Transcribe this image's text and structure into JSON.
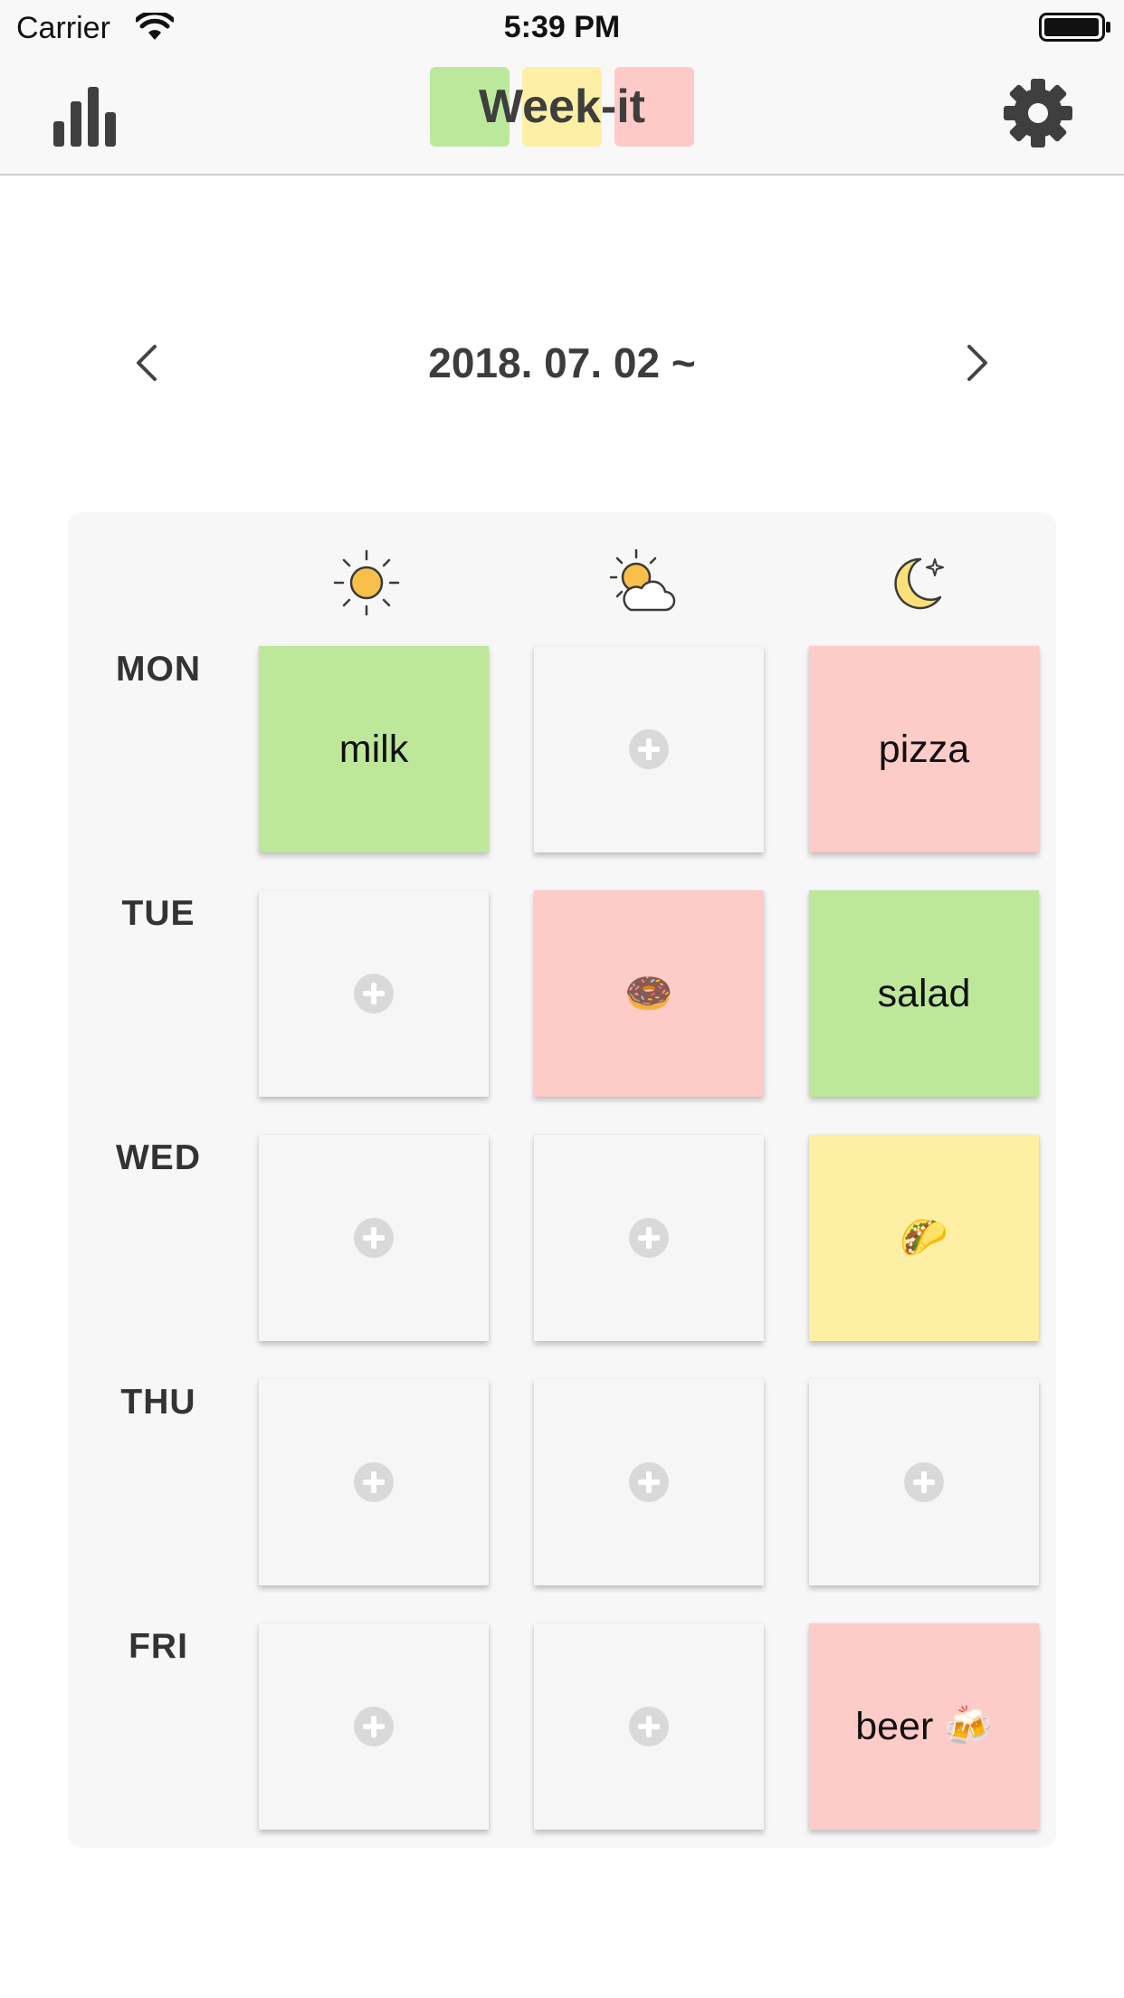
{
  "status_bar": {
    "carrier": "Carrier",
    "time": "5:39 PM"
  },
  "nav": {
    "title": "Week-it",
    "logo_colors": [
      "#bce89b",
      "#fdf0a6",
      "#fdcac7"
    ],
    "stats_icon": "bar-chart-icon",
    "settings_icon": "gear-icon"
  },
  "week": {
    "label": "2018. 07. 02 ~",
    "prev_icon": "chevron-left-icon",
    "next_icon": "chevron-right-icon"
  },
  "meals": [
    {
      "icon": "sun-icon"
    },
    {
      "icon": "sun-cloud-icon"
    },
    {
      "icon": "moon-icon"
    }
  ],
  "days": [
    {
      "label": "MON",
      "cells": [
        {
          "text": "milk",
          "color": "green"
        },
        {
          "text": "",
          "color": "empty"
        },
        {
          "text": "pizza",
          "color": "pink"
        }
      ]
    },
    {
      "label": "TUE",
      "cells": [
        {
          "text": "",
          "color": "empty"
        },
        {
          "text": "🍩",
          "color": "pink"
        },
        {
          "text": "salad",
          "color": "green"
        }
      ]
    },
    {
      "label": "WED",
      "cells": [
        {
          "text": "",
          "color": "empty"
        },
        {
          "text": "",
          "color": "empty"
        },
        {
          "text": "🌮",
          "color": "yellow"
        }
      ]
    },
    {
      "label": "THU",
      "cells": [
        {
          "text": "",
          "color": "empty"
        },
        {
          "text": "",
          "color": "empty"
        },
        {
          "text": "",
          "color": "empty"
        }
      ]
    },
    {
      "label": "FRI",
      "cells": [
        {
          "text": "",
          "color": "empty"
        },
        {
          "text": "",
          "color": "empty"
        },
        {
          "text": "beer 🍻",
          "color": "pink"
        }
      ]
    }
  ],
  "colors": {
    "green": "#bde89a",
    "pink": "#fdcbc8",
    "yellow": "#fdf0a5",
    "empty": "#f6f6f6"
  }
}
